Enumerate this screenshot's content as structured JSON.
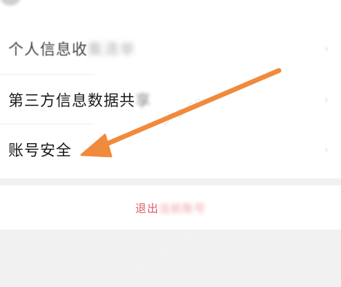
{
  "settings": {
    "items": [
      {
        "label_clear": "个人信息收",
        "label_blurred": "集清单"
      },
      {
        "label_clear": "第三方信息数据共",
        "label_blurred": "享"
      },
      {
        "label_clear": "账号安全",
        "label_blurred": ""
      }
    ],
    "chevron_glyph": "›"
  },
  "logout": {
    "label_clear": "退出",
    "label_blurred": "当前账号"
  },
  "watermarks": [
    "php.cn",
    "php.cn"
  ],
  "annotation": {
    "arrow_color": "#f08a3c",
    "target": "账号安全"
  },
  "colors": {
    "page_background": "#f1f1f1",
    "card_background": "#ffffff",
    "logout_text": "#e05a66"
  }
}
